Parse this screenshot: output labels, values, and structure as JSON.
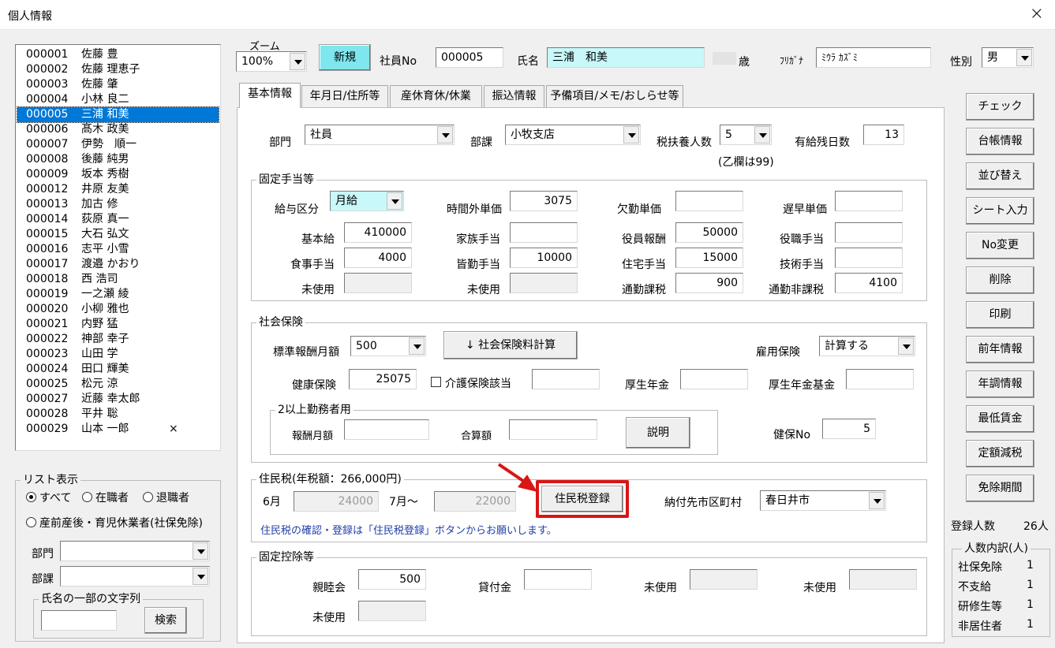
{
  "window": {
    "title": "個人情報",
    "close": "×"
  },
  "employees": [
    {
      "code": "000001",
      "name": "佐藤 豊",
      "mark": ""
    },
    {
      "code": "000002",
      "name": "佐藤 理恵子",
      "mark": ""
    },
    {
      "code": "000003",
      "name": "佐藤 肇",
      "mark": ""
    },
    {
      "code": "000004",
      "name": "小林 良二",
      "mark": ""
    },
    {
      "code": "000005",
      "name": "三浦 和美",
      "mark": "",
      "selected": true
    },
    {
      "code": "000006",
      "name": "髙木 政美",
      "mark": ""
    },
    {
      "code": "000007",
      "name": "伊勢　順一",
      "mark": ""
    },
    {
      "code": "000008",
      "name": "後藤 純男",
      "mark": ""
    },
    {
      "code": "000009",
      "name": "坂本 秀樹",
      "mark": ""
    },
    {
      "code": "000012",
      "name": "井原 友美",
      "mark": ""
    },
    {
      "code": "000013",
      "name": "加古 修",
      "mark": ""
    },
    {
      "code": "000014",
      "name": "荻原 真一",
      "mark": ""
    },
    {
      "code": "000015",
      "name": "大石 弘文",
      "mark": ""
    },
    {
      "code": "000016",
      "name": "志平 小雪",
      "mark": ""
    },
    {
      "code": "000017",
      "name": "渡邉 かおり",
      "mark": ""
    },
    {
      "code": "000018",
      "name": "西 浩司",
      "mark": ""
    },
    {
      "code": "000019",
      "name": "一之瀬 綾",
      "mark": ""
    },
    {
      "code": "000020",
      "name": "小柳 雅也",
      "mark": ""
    },
    {
      "code": "000021",
      "name": "内野 猛",
      "mark": ""
    },
    {
      "code": "000022",
      "name": "神部 幸子",
      "mark": ""
    },
    {
      "code": "000023",
      "name": "山田 学",
      "mark": ""
    },
    {
      "code": "000024",
      "name": "田口 輝美",
      "mark": ""
    },
    {
      "code": "000025",
      "name": "松元 涼",
      "mark": ""
    },
    {
      "code": "000027",
      "name": "近藤 幸太郎",
      "mark": ""
    },
    {
      "code": "000028",
      "name": "平井 聡",
      "mark": ""
    },
    {
      "code": "000029",
      "name": "山本 一郎",
      "mark": "×"
    }
  ],
  "list_display": {
    "caption": "リスト表示",
    "all": "すべて",
    "employed": "在職者",
    "retired": "退職者",
    "leave": "産前産後・育児休業者(社保免除)",
    "dept_label": "部門",
    "section_label": "部課",
    "name_search_caption": "氏名の一部の文字列",
    "search_button": "検索"
  },
  "header": {
    "zoom_label": "ズーム",
    "zoom_value": "100%",
    "new_button": "新規",
    "emp_no_label": "社員No",
    "emp_no": "000005",
    "name_label": "氏名",
    "name": "三浦　和美",
    "age_unit": "歳",
    "furigana_label": "ﾌﾘｶﾞﾅ",
    "furigana": "ﾐｳﾗ ｶｽﾞﾐ",
    "gender_label": "性別",
    "gender": "男"
  },
  "tabs": [
    "基本情報",
    "年月日/住所等",
    "産休育休/休業",
    "振込情報",
    "予備項目/メモ/おしらせ等"
  ],
  "basic": {
    "dept_label": "部門",
    "dept": "社員",
    "section_label": "部課",
    "section": "小牧支店",
    "dependents_label": "税扶養人数",
    "dependents": "5",
    "dependents_note": "(乙欄は99)",
    "paid_leave_label": "有給残日数",
    "paid_leave": "13"
  },
  "allowances": {
    "caption": "固定手当等",
    "pay_type_label": "給与区分",
    "pay_type": "月給",
    "overtime_label": "時間外単価",
    "overtime": "3075",
    "absence_label": "欠勤単価",
    "absence": "",
    "late_label": "遅早単価",
    "late": "",
    "base_label": "基本給",
    "base": "410000",
    "family_label": "家族手当",
    "family": "",
    "officer_label": "役員報酬",
    "officer": "50000",
    "position_label": "役職手当",
    "position": "",
    "meal_label": "食事手当",
    "meal": "4000",
    "attendance_label": "皆勤手当",
    "attendance": "10000",
    "housing_label": "住宅手当",
    "housing": "15000",
    "skill_label": "技術手当",
    "skill": "",
    "unused1_label": "未使用",
    "unused2_label": "未使用",
    "commute_tax_label": "通勤課税",
    "commute_tax": "900",
    "commute_free_label": "通勤非課税",
    "commute_free": "4100"
  },
  "social": {
    "caption": "社会保険",
    "std_label": "標準報酬月額",
    "std": "500",
    "calc_button": "↓  社会保険料計算",
    "employment_label": "雇用保険",
    "employment": "計算する",
    "health_label": "健康保険",
    "health": "25075",
    "care_label": "介護保険該当",
    "care": "",
    "pension_label": "厚生年金",
    "pension": "",
    "pension_fund_label": "厚生年金基金",
    "pension_fund": "",
    "multi_caption": "2以上勤務者用",
    "monthly_label": "報酬月額",
    "total_label": "合算額",
    "explain_button": "説明",
    "health_no_label": "健保No",
    "health_no": "5"
  },
  "resident": {
    "caption": "住民税(年税額：266,000円)",
    "june_label": "6月",
    "june": "24000",
    "july_label": "7月～",
    "july": "22000",
    "register_button": "住民税登録",
    "city_label": "納付先市区町村",
    "city": "春日井市",
    "note": "住民税の確認・登録は「住民税登録」ボタンからお願いします。",
    "note_color": "#1f3ea8",
    "highlight_color": "#d91515"
  },
  "deductions": {
    "caption": "固定控除等",
    "social_club_label": "親睦会",
    "social_club": "500",
    "loan_label": "貸付金",
    "loan": "",
    "unused_label": "未使用"
  },
  "side_buttons": [
    "チェック",
    "台帳情報",
    "並び替え",
    "シート入力",
    "No変更",
    "削除",
    "印刷",
    "前年情報",
    "年調情報",
    "最低賃金",
    "定額減税",
    "免除期間"
  ],
  "counts": {
    "registered_label": "登録人数",
    "registered": "26人",
    "breakdown_caption": "人数内訳(人)",
    "rows": [
      {
        "label": "社保免除",
        "value": "1"
      },
      {
        "label": "不支給",
        "value": "1"
      },
      {
        "label": "研修生等",
        "value": "1"
      },
      {
        "label": "非居住者",
        "value": "1"
      }
    ]
  }
}
